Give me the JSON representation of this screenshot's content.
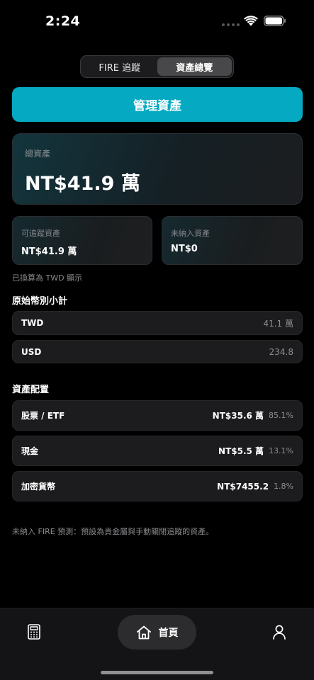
{
  "status_bar": {
    "time": "2:24"
  },
  "segmented": {
    "tabs": [
      {
        "label": "FIRE 追蹤",
        "active": false
      },
      {
        "label": "資產總覽",
        "active": true
      }
    ]
  },
  "manage_button": {
    "label": "管理資產",
    "color": "#06a9c2"
  },
  "total": {
    "label": "總資產",
    "value": "NT$41.9 萬"
  },
  "trackable": {
    "label": "可追蹤資產",
    "value": "NT$41.9 萬"
  },
  "untracked": {
    "label": "未納入資產",
    "value": "NT$0"
  },
  "converted_note": "已換算為 TWD 顯示",
  "currency_section": {
    "title": "原始幣別小計",
    "rows": [
      {
        "currency": "TWD",
        "amount": "41.1 萬"
      },
      {
        "currency": "USD",
        "amount": "234.8"
      }
    ]
  },
  "allocation_section": {
    "title": "資產配置",
    "rows": [
      {
        "label": "股票 / ETF",
        "amount": "NT$35.6 萬",
        "percent": "85.1%"
      },
      {
        "label": "現金",
        "amount": "NT$5.5 萬",
        "percent": "13.1%"
      },
      {
        "label": "加密貨幣",
        "amount": "NT$7455.2",
        "percent": "1.8%"
      }
    ]
  },
  "footnote": "未納入 FIRE 預測：預設為貴金屬與手動關閉追蹤的資產。",
  "tab_bar": {
    "left_icon": "calculator-icon",
    "home_icon": "home-icon",
    "home_label": "首頁",
    "right_icon": "user-icon"
  }
}
